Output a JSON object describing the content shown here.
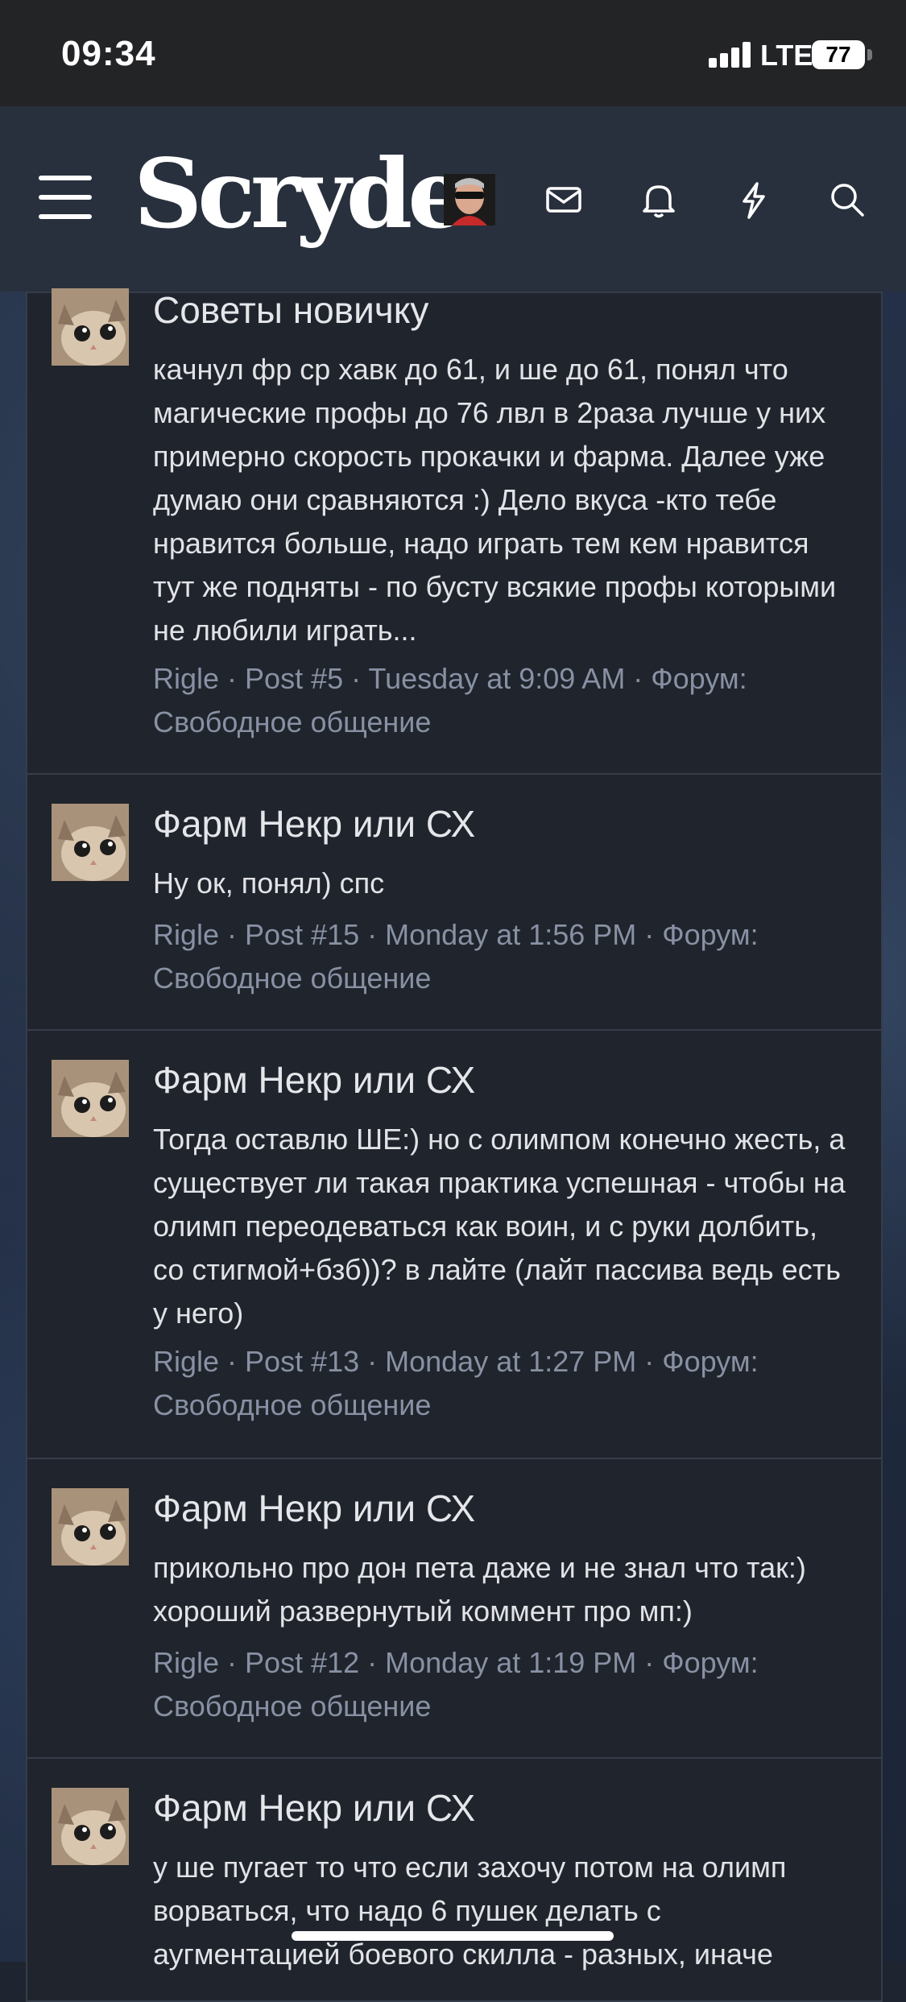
{
  "status_bar": {
    "time": "09:34",
    "network": "LTE",
    "battery": "77"
  },
  "header": {
    "logo": "Scryde"
  },
  "posts": [
    {
      "title": "Советы новичку",
      "snippet": "качнул фр ср хавк до 61, и ше до 61, понял что магические профы до 76 лвл в 2раза лучше у них примерно скорость прокачки и фарма. Далее уже думаю они сравняются :) Дело вкуса -кто тебе нравится больше, надо играть тем кем нравится тут же подняты - по бусту всякие профы которыми не любили играть...",
      "meta": "Rigle · Post #5 · Tuesday at 9:09 AM · Форум: Свободное общение"
    },
    {
      "title": "Фарм Некр или СХ",
      "snippet": "Ну ок, понял) спс",
      "meta": "Rigle · Post #15 · Monday at 1:56 PM · Форум: Свободное общение"
    },
    {
      "title": "Фарм Некр или СХ",
      "snippet": "Тогда оставлю ШЕ:) но с олимпом конечно жесть, а существует ли такая практика успешная - чтобы на олимп переодеваться как воин, и с руки долбить, со стигмой+бзб))? в лайте (лайт пассива ведь есть у него)",
      "meta": "Rigle · Post #13 · Monday at 1:27 PM · Форум: Свободное общение"
    },
    {
      "title": "Фарм Некр или СХ",
      "snippet": "прикольно про дон пета даже и не знал что так:) хороший развернутый коммент про мп:)",
      "meta": "Rigle · Post #12 · Monday at 1:19 PM · Форум: Свободное общение"
    },
    {
      "title": "Фарм Некр или СХ",
      "snippet": "у ше пугает то что если захочу потом на олимп ворваться, что надо 6 пушек делать с аугментацией боевого скилла - разных, иначе",
      "meta": ""
    }
  ]
}
